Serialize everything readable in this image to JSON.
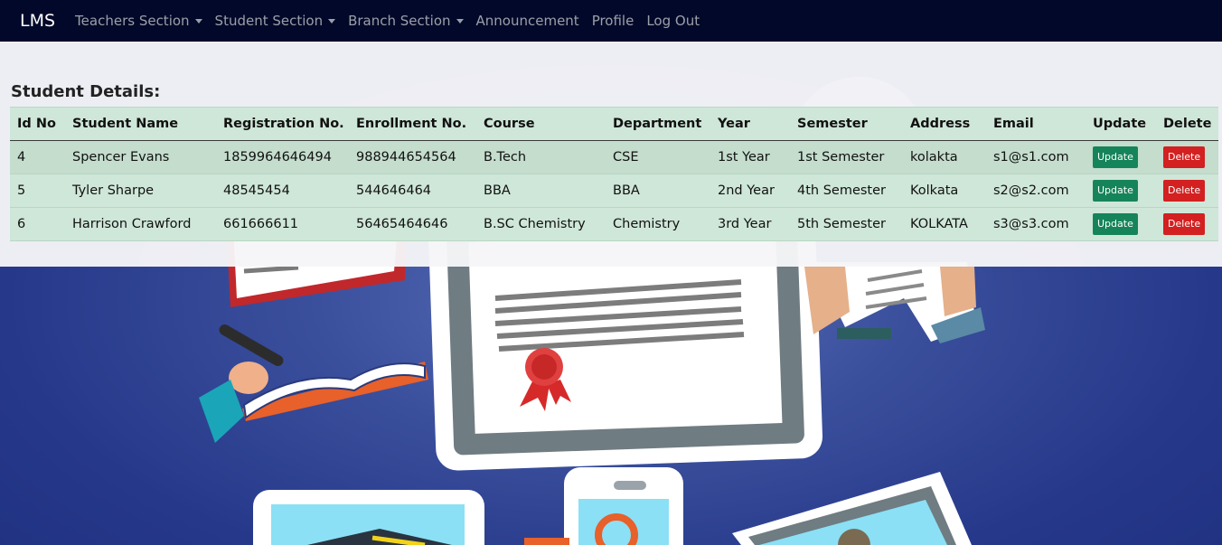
{
  "nav": {
    "brand": "LMS",
    "items": [
      {
        "label": "Teachers Section",
        "dropdown": true
      },
      {
        "label": "Student Section",
        "dropdown": true
      },
      {
        "label": "Branch Section",
        "dropdown": true
      },
      {
        "label": "Announcement",
        "dropdown": false
      },
      {
        "label": "Profile",
        "dropdown": false
      },
      {
        "label": "Log Out",
        "dropdown": false
      }
    ]
  },
  "main": {
    "heading": "Student Details:",
    "table": {
      "headers": [
        "Id No",
        "Student Name",
        "Registration No.",
        "Enrollment No.",
        "Course",
        "Department",
        "Year",
        "Semester",
        "Address",
        "Email",
        "Update",
        "Delete"
      ],
      "rows": [
        [
          "4",
          "Spencer Evans",
          "1859964646494",
          "988944654564",
          "B.Tech",
          "CSE",
          "1st Year",
          "1st Semester",
          "kolakta",
          "s1@s1.com"
        ],
        [
          "5",
          "Tyler Sharpe",
          "48545454",
          "544646464",
          "BBA",
          "BBA",
          "2nd Year",
          "4th Semester",
          "Kolkata",
          "s2@s2.com"
        ],
        [
          "6",
          "Harrison Crawford",
          "661666611",
          "56465464646",
          "B.SC Chemistry",
          "Chemistry",
          "3rd Year",
          "5th Semester",
          "KOLKATA",
          "s3@s3.com"
        ]
      ],
      "update_label": "Update",
      "delete_label": "Delete"
    }
  },
  "colors": {
    "navbar": "#020829",
    "update_button": "#16845a",
    "delete_button": "#d32020",
    "background": "#26388a"
  }
}
